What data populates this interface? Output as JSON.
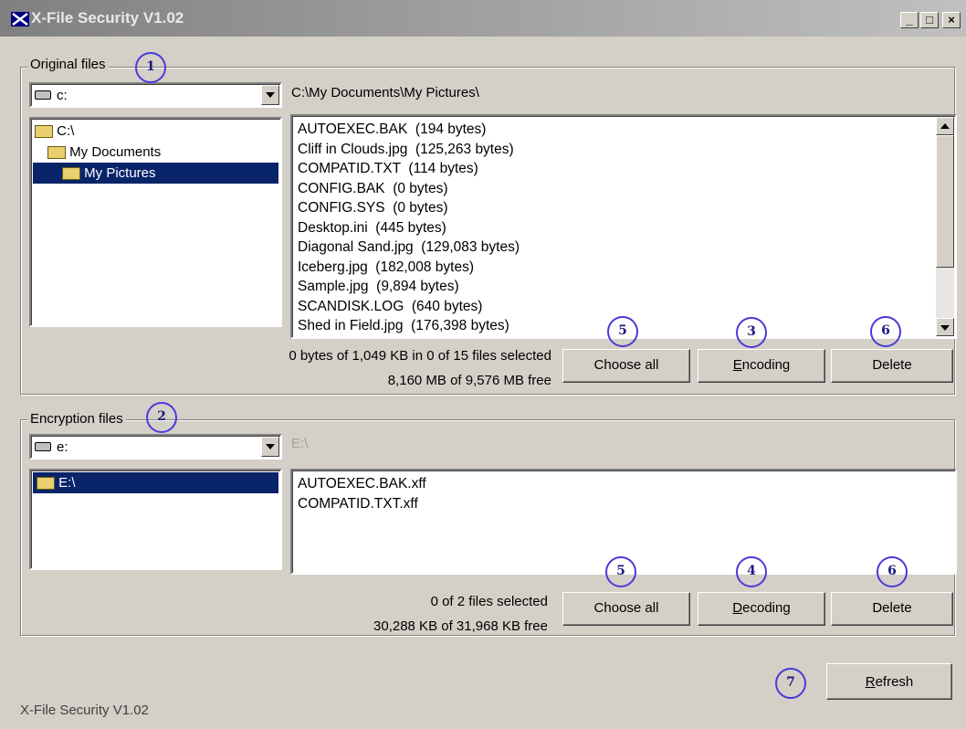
{
  "window": {
    "title": "X-File Security V1.02",
    "min_label": "_",
    "max_label": "□",
    "close_label": "×"
  },
  "original": {
    "legend": "Original files",
    "drive": "c:",
    "path": "C:\\My Documents\\My Pictures\\",
    "tree": [
      "C:\\",
      "My Documents",
      "My Pictures"
    ],
    "files": [
      "AUTOEXEC.BAK  (194 bytes)",
      "Cliff in Clouds.jpg  (125,263 bytes)",
      "COMPATID.TXT  (114 bytes)",
      "CONFIG.BAK  (0 bytes)",
      "CONFIG.SYS  (0 bytes)",
      "Desktop.ini  (445 bytes)",
      "Diagonal Sand.jpg  (129,083 bytes)",
      "Iceberg.jpg  (182,008 bytes)",
      "Sample.jpg  (9,894 bytes)",
      "SCANDISK.LOG  (640 bytes)",
      "Shed in Field.jpg  (176,398 bytes)"
    ],
    "status_selected": "0 bytes of 1,049 KB in 0 of 15 files selected",
    "status_free": "8,160 MB of 9,576 MB free",
    "choose_all": "Choose all",
    "action": "Encoding",
    "delete": "Delete"
  },
  "encryption": {
    "legend": "Encryption files",
    "drive": "e:",
    "path": "E:\\",
    "tree": [
      "E:\\"
    ],
    "files": [
      "AUTOEXEC.BAK.xff",
      "COMPATID.TXT.xff"
    ],
    "status_selected": "0 of 2 files selected",
    "status_free": "30,288 KB of 31,968 KB free",
    "choose_all": "Choose all",
    "action": "Decoding",
    "delete": "Delete"
  },
  "refresh": "Refresh",
  "statusbar": "X-File Security V1.02",
  "callouts": [
    "1",
    "2",
    "3",
    "4",
    "5",
    "5",
    "6",
    "6",
    "7"
  ],
  "colors": {
    "selection": "#0a246a",
    "callout": "#4a3ad8",
    "face": "#d4d0c8"
  }
}
